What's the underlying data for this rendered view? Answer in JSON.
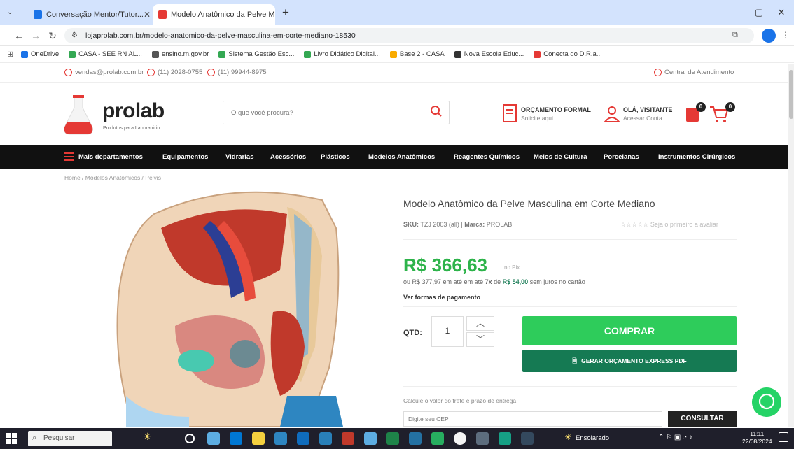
{
  "browser": {
    "tabs": [
      {
        "title": "Conversação Mentor/Tutor...",
        "favicon_color": "#1a73e8"
      },
      {
        "title": "Modelo Anatômico da Pelve M...",
        "favicon_color": "#e53935",
        "active": true
      }
    ],
    "url": "lojaprolab.com.br/modelo-anatomico-da-pelve-masculina-em-corte-mediano-18530",
    "bookmarks": [
      {
        "label": "OneDrive",
        "color": "#1a73e8"
      },
      {
        "label": "CASA - SEE RN AL...",
        "color": "#34a853"
      },
      {
        "label": "ensino.rn.gov.br",
        "color": "#555555"
      },
      {
        "label": "Sistema Gestão Esc...",
        "color": "#34a853"
      },
      {
        "label": "Livro Didático Digital...",
        "color": "#34a853"
      },
      {
        "label": "Base 2 - CASA",
        "color": "#f9ab00"
      },
      {
        "label": "Nova Escola Educ...",
        "color": "#333333"
      },
      {
        "label": "Conecta do D.R.a...",
        "color": "#e53935"
      }
    ]
  },
  "site": {
    "contact": {
      "email": "vendas@prolab.com.br",
      "phone1": "(11) 2028-0755",
      "phone2": "(11) 99944-8975",
      "service": "Central de Atendimento"
    },
    "logo": {
      "name": "prolab",
      "tagline": "Produtos para Laboratório"
    },
    "search_placeholder": "O que você procura?",
    "quote": {
      "label": "ORÇAMENTO FORMAL",
      "sub": "Solicite aqui"
    },
    "account": {
      "label": "OLÁ, VISITANTE",
      "sub": "Acessar Conta"
    },
    "wishlist_count": "0",
    "cart_count": "0"
  },
  "nav": {
    "all": "Mais departamentos",
    "items": [
      "Equipamentos",
      "Vidrarias",
      "Acessórios",
      "Plásticos",
      "Modelos Anatômicos",
      "Reagentes Químicos",
      "Meios de Cultura",
      "Porcelanas",
      "Instrumentos Cirúrgicos"
    ]
  },
  "breadcrumb": "Home  /  Modelos Anatômicos  /  Pélvis",
  "product": {
    "title": "Modelo Anatômico da Pelve Masculina em Corte Mediano",
    "sku_label": "SKU:",
    "sku": "TZJ 2003 (all)",
    "brand_label": "Marca:",
    "brand": "PROLAB",
    "rating_text": "☆☆☆☆☆  Seja o primeiro a avaliar",
    "price": "R$ 366,63",
    "price_tag": "no Pix",
    "installments_pre": "ou R$ 377,97 em até em até",
    "installments_count": "7x",
    "installments_mid": "de",
    "installments_value": "R$ 54,00",
    "installments_post": "sem juros no cartão",
    "payment_forms": "Ver formas de pagamento",
    "qty_label": "QTD:",
    "qty": "1",
    "buy": "COMPRAR",
    "quote_pdf": "GERAR ORÇAMENTO EXPRESS PDF",
    "cep_label": "Calcule o valor do frete e prazo de entrega",
    "cep_placeholder": "Digite seu CEP",
    "consult": "CONSULTAR"
  },
  "taskbar": {
    "search": "Pesquisar",
    "weather": "Ensolarado",
    "time": "11:11",
    "date": "22/08/2024"
  }
}
